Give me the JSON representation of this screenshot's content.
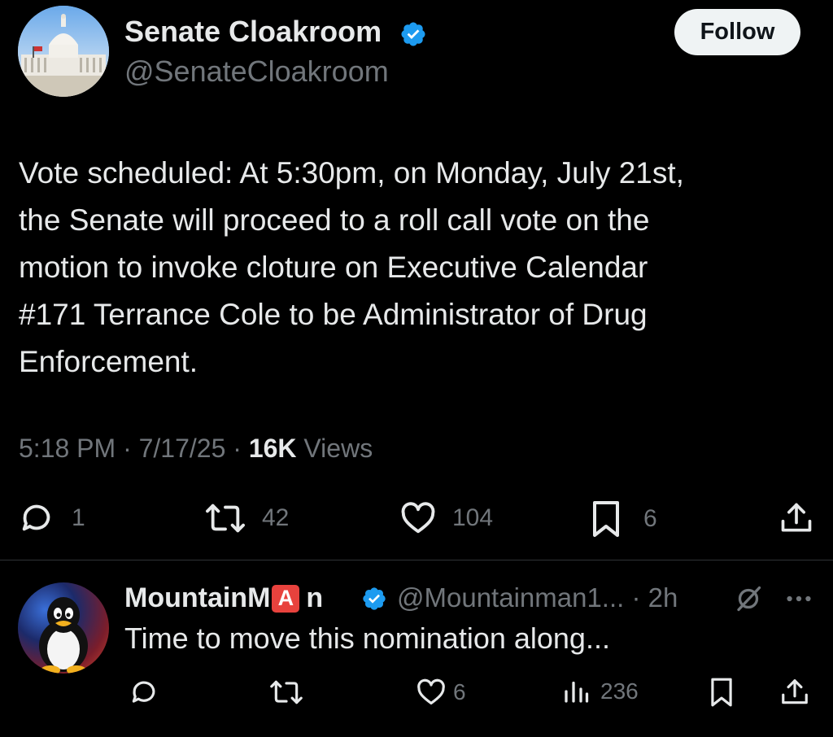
{
  "main_tweet": {
    "author": {
      "name": "Senate Cloakroom",
      "handle": "@SenateCloakroom",
      "verified": true,
      "avatar": "capitol-building"
    },
    "follow_label": "Follow",
    "text": "Vote scheduled: At 5:30pm, on Monday, July 21st,\nthe Senate will proceed to a roll call vote on the\nmotion to invoke cloture on Executive Calendar\n#171 Terrance Cole to be Administrator of Drug\nEnforcement.",
    "time": "5:18 PM",
    "date": "7/17/25",
    "views_count": "16K",
    "views_label": "Views",
    "separator": "·",
    "actions": {
      "replies": "1",
      "reposts": "42",
      "likes": "104",
      "bookmarks": "6"
    }
  },
  "reply": {
    "author": {
      "name_prefix": "MountainM",
      "name_badge": "A",
      "name_suffix": "n",
      "handle": "@Mountainman1...",
      "verified": true,
      "avatar": "penguin"
    },
    "time": "· 2h",
    "text": "Time to move this nomination along...",
    "actions": {
      "replies": "",
      "reposts": "",
      "likes": "6",
      "views": "236"
    }
  },
  "colors": {
    "background": "#000000",
    "text_primary": "#e7e9ea",
    "text_secondary": "#71767b",
    "verified_blue": "#1d9bf0",
    "badge_red": "#e8423d",
    "follow_bg": "#eff3f4"
  }
}
